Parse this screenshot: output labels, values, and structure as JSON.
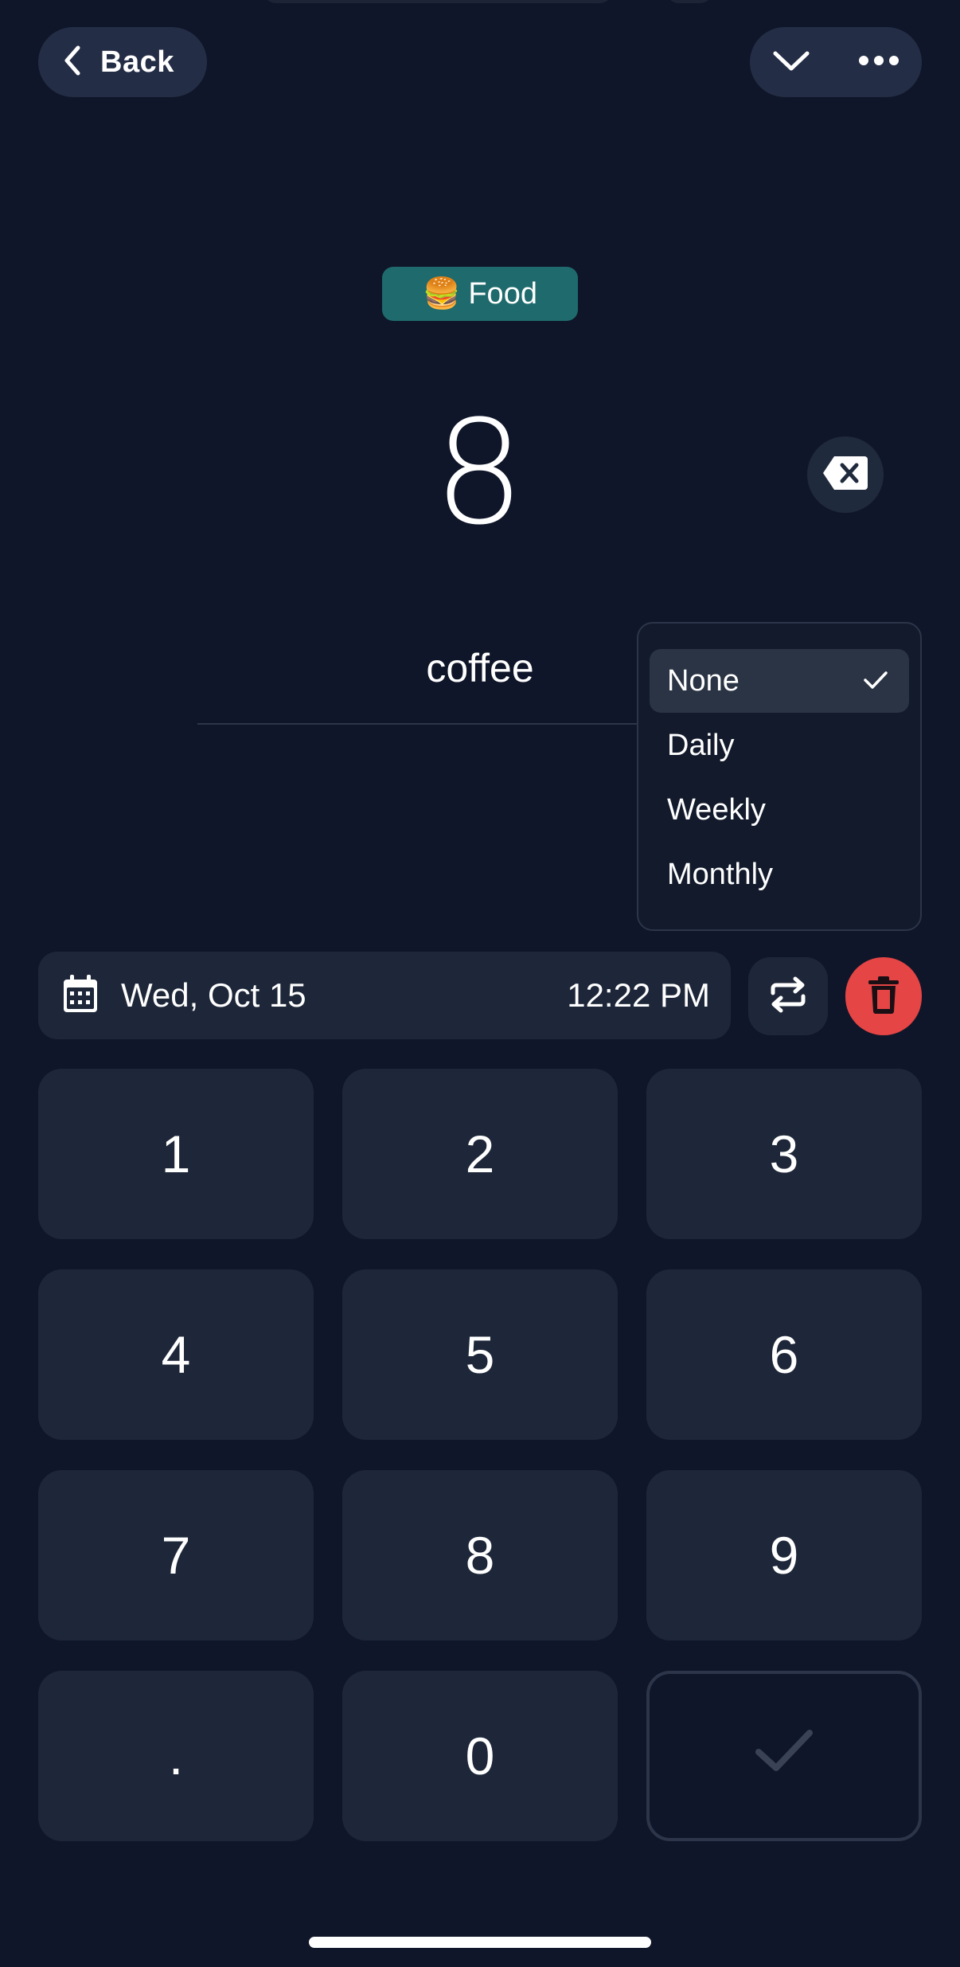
{
  "header": {
    "back_label": "Back",
    "collapse_icon": "chevron-down-icon",
    "more_icon": "more-horizontal-icon"
  },
  "category": {
    "emoji": "🍔",
    "label": "Food",
    "color": "#1e6a6c"
  },
  "amount": {
    "value": "8"
  },
  "note": {
    "value": "coffee"
  },
  "recurrence_menu": {
    "items": [
      {
        "label": "None",
        "selected": true
      },
      {
        "label": "Daily",
        "selected": false
      },
      {
        "label": "Weekly",
        "selected": false
      },
      {
        "label": "Monthly",
        "selected": false
      }
    ]
  },
  "datetime": {
    "date": "Wed, Oct 15",
    "time": "12:22 PM"
  },
  "keypad": {
    "keys": [
      "1",
      "2",
      "3",
      "4",
      "5",
      "6",
      "7",
      "8",
      "9",
      ".",
      "0"
    ]
  },
  "colors": {
    "background": "#0f1629",
    "surface": "#1e2739",
    "danger": "#e54545",
    "accent": "#1e6a6c"
  }
}
